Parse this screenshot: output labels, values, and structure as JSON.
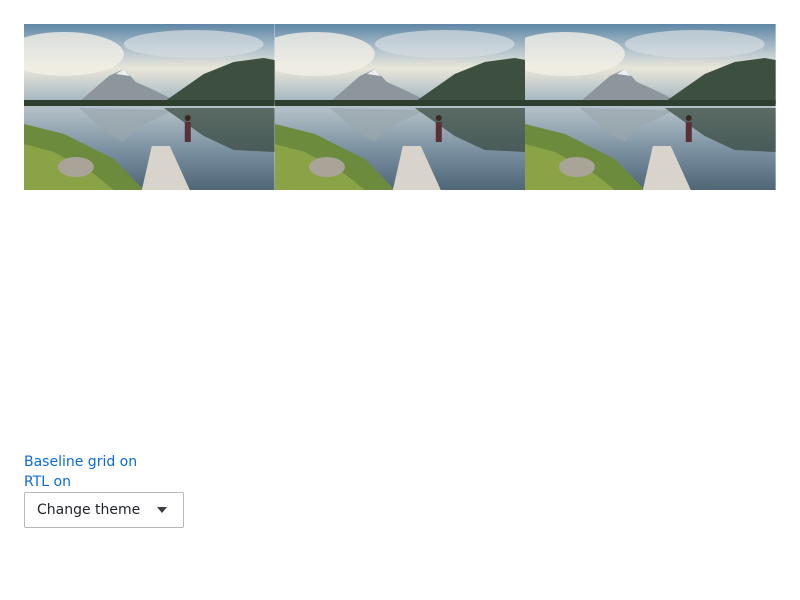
{
  "gallery": {
    "images": [
      {
        "alt_semantic": "mountain-lake-dock-photo"
      },
      {
        "alt_semantic": "mountain-lake-dock-photo"
      },
      {
        "alt_semantic": "mountain-lake-dock-photo"
      }
    ]
  },
  "controls": {
    "baseline_grid_label": "Baseline grid on",
    "rtl_label": "RTL on",
    "theme_select_label": "Change theme",
    "theme_select_icon": "caret-down-icon"
  },
  "colors": {
    "link": "#0b6bd6",
    "select_border": "#b5b8bd",
    "text": "#1f2328"
  }
}
